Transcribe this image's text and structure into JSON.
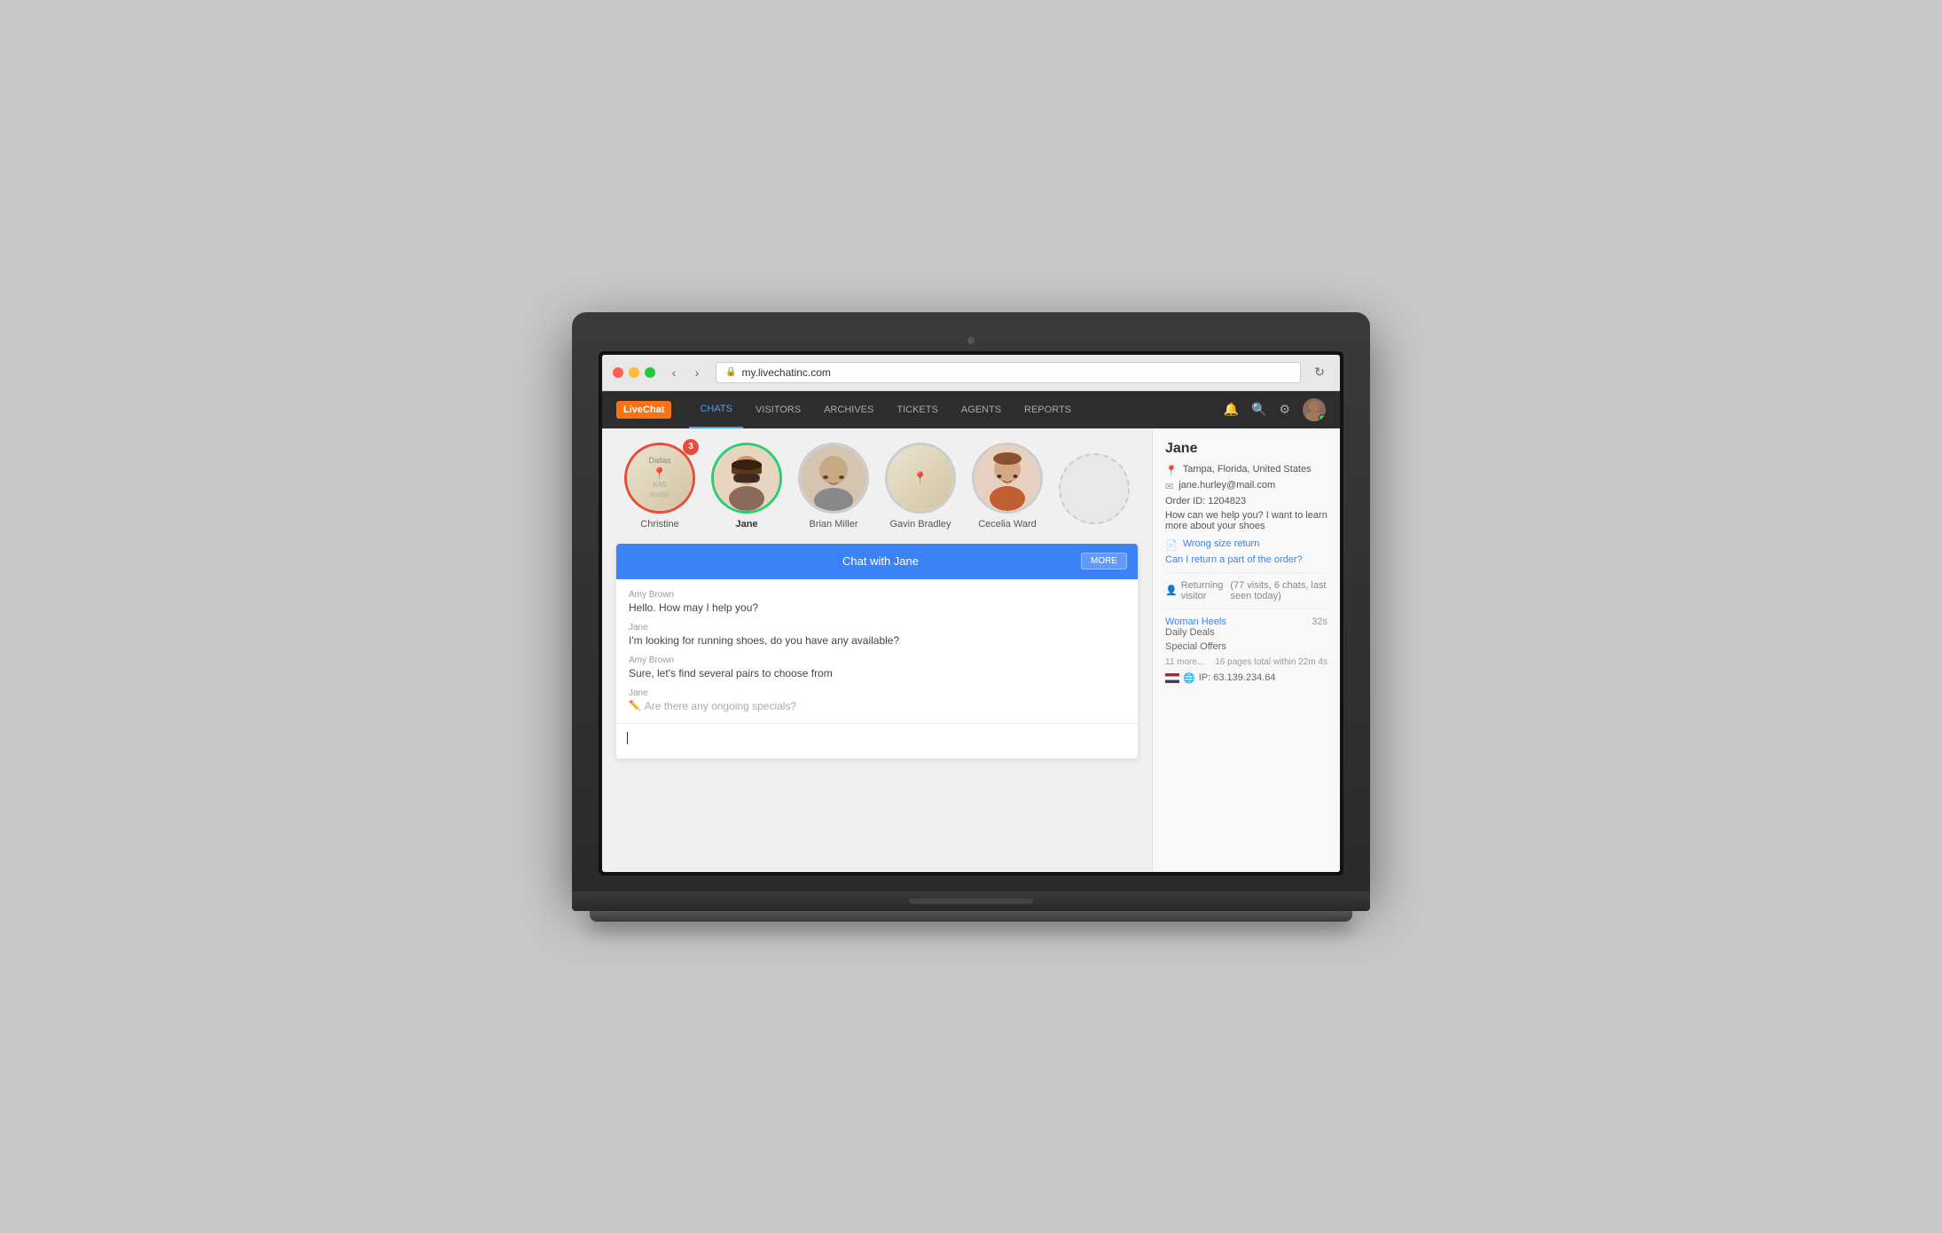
{
  "browser": {
    "url": "my.livechatinc.com",
    "reload_label": "↻"
  },
  "nav": {
    "logo": "LiveChat",
    "links": [
      {
        "id": "chats",
        "label": "CHATS",
        "active": true
      },
      {
        "id": "visitors",
        "label": "VISITORS",
        "active": false
      },
      {
        "id": "archives",
        "label": "ARCHIVES",
        "active": false
      },
      {
        "id": "tickets",
        "label": "TICKETS",
        "active": false
      },
      {
        "id": "agents",
        "label": "AGENTS",
        "active": false
      },
      {
        "id": "reports",
        "label": "REPORTS",
        "active": false
      }
    ]
  },
  "visitors": [
    {
      "id": "christine",
      "name": "Christine",
      "badge": "3",
      "border": "red",
      "type": "map"
    },
    {
      "id": "jane",
      "name": "Jane",
      "badge": null,
      "border": "green",
      "type": "photo",
      "bold": true
    },
    {
      "id": "brian",
      "name": "Brian Miller",
      "badge": null,
      "border": "gray",
      "type": "photo"
    },
    {
      "id": "gavin",
      "name": "Gavin Bradley",
      "badge": null,
      "border": "gray",
      "type": "map2"
    },
    {
      "id": "cecelia",
      "name": "Cecelia Ward",
      "badge": null,
      "border": "gray",
      "type": "photo2"
    },
    {
      "id": "unknown",
      "name": "",
      "badge": null,
      "border": "dashed",
      "type": "empty"
    }
  ],
  "chat": {
    "title": "Chat with Jane",
    "more_label": "MORE",
    "messages": [
      {
        "sender": "Amy Brown",
        "text": "Hello. How may I help you?",
        "typing": false
      },
      {
        "sender": "Jane",
        "text": "I'm looking for running shoes, do you have any available?",
        "typing": false
      },
      {
        "sender": "Amy Brown",
        "text": "Sure, let's find several pairs to choose from",
        "typing": false
      },
      {
        "sender": "Jane",
        "text": "Are there any ongoing specials?",
        "typing": true
      }
    ]
  },
  "sidebar": {
    "name": "Jane",
    "location": "Tampa, Florida, United States",
    "email": "jane.hurley@mail.com",
    "order_id_label": "Order ID: 1204823",
    "help_text": "How can we help you? I want to learn more about your shoes",
    "links": [
      {
        "label": "Wrong size return"
      },
      {
        "label": "Can I return a part of the order?"
      }
    ],
    "returning_text": "Returning visitor",
    "visits_text": "(77 visits, 6 chats, last seen today)",
    "pages": [
      {
        "label": "Woman Heels",
        "time": "32s"
      },
      {
        "label": "Daily Deals",
        "time": ""
      },
      {
        "label": "Special Offers",
        "time": ""
      }
    ],
    "more_pages": "11 more...",
    "total_pages": "16 pages total within 22m 4s",
    "ip": "IP: 63.139.234.64"
  }
}
